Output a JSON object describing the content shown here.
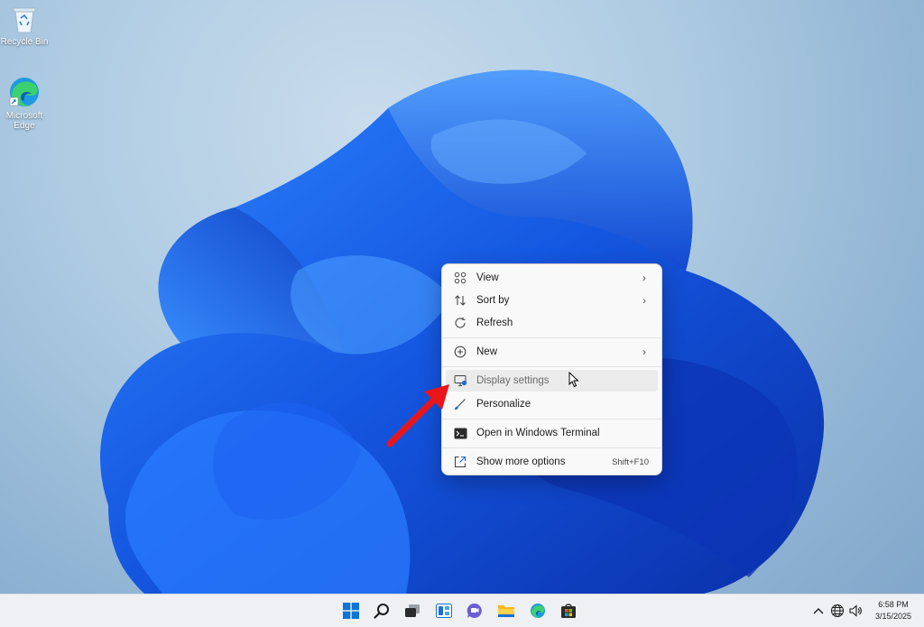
{
  "desktop": {
    "icons": [
      {
        "label": "Recycle Bin",
        "icon": "recycle-bin-icon"
      },
      {
        "label": "Microsoft Edge",
        "icon": "edge-icon"
      }
    ]
  },
  "context_menu": {
    "items": [
      {
        "label": "View",
        "icon": "grid-view-icon",
        "has_submenu": true
      },
      {
        "label": "Sort by",
        "icon": "sort-icon",
        "has_submenu": true
      },
      {
        "label": "Refresh",
        "icon": "refresh-icon",
        "has_submenu": false
      },
      {
        "label": "New",
        "icon": "plus-circle-icon",
        "has_submenu": true
      },
      {
        "label": "Display settings",
        "icon": "display-icon",
        "has_submenu": false,
        "highlighted": true
      },
      {
        "label": "Personalize",
        "icon": "brush-icon",
        "has_submenu": false
      },
      {
        "label": "Open in Windows Terminal",
        "icon": "terminal-icon",
        "has_submenu": false
      },
      {
        "label": "Show more options",
        "icon": "share-icon",
        "shortcut": "Shift+F10"
      }
    ]
  },
  "taskbar": {
    "apps": [
      "start-icon",
      "search-icon",
      "task-view-icon",
      "widgets-icon",
      "chat-icon",
      "file-explorer-icon",
      "edge-icon",
      "store-icon"
    ],
    "tray": {
      "time": "6:58 PM",
      "date": "3/15/2025"
    }
  },
  "colors": {
    "accent": "#0067c0",
    "bloom": "#1a5fe0",
    "annotation_arrow": "#e8161b"
  }
}
